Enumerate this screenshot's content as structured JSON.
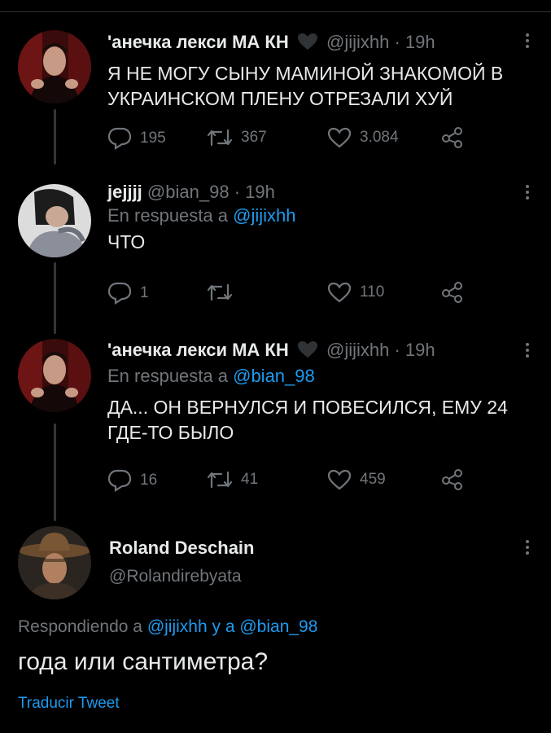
{
  "tweets": [
    {
      "name": "'анечка лекси МА КН",
      "handle": "@jijixhh",
      "dot": "·",
      "time": "19h",
      "text_lines": [
        "Я НЕ МОГУ СЫНУ МАМИНОЙ ЗНАКОМОЙ В",
        "УКРАИНСКОМ ПЛЕНУ ОТРЕЗАЛИ ХУЙ"
      ],
      "replies": "195",
      "retweets": "367",
      "likes": "3.084"
    },
    {
      "name": "jejjjj",
      "handle": "@bian_98",
      "dot": "·",
      "time": "19h",
      "reply_prefix": "En respuesta a",
      "reply_mention": "@jijixhh",
      "text_lines": [
        "ЧТО"
      ],
      "replies": "1",
      "retweets": "",
      "likes": "110"
    },
    {
      "name": "'анечка лекси МА КН",
      "handle": "@jijixhh",
      "dot": "·",
      "time": "19h",
      "reply_prefix": "En respuesta a",
      "reply_mention": "@bian_98",
      "text_lines": [
        "ДА... ОН ВЕРНУЛСЯ И ПОВЕСИЛСЯ, ЕМУ 24",
        "ГДЕ-ТО БЫЛО"
      ],
      "replies": "16",
      "retweets": "41",
      "likes": "459"
    }
  ],
  "main": {
    "name": "Roland Deschain",
    "handle": "@Rolandirebyata",
    "reply_prefix": "Respondiendo a",
    "mention_1": "@jijixhh",
    "conj": "y a",
    "mention_2": "@bian_98",
    "text": "года или сантиметра?",
    "translate": "Traducir Tweet"
  },
  "colors": {
    "background": "#000000",
    "text": "#e7e9ea",
    "muted": "#71767b",
    "link": "#1d9bf0",
    "thread_line": "#333639"
  },
  "icons": [
    "black-heart-icon",
    "more-icon",
    "reply-icon",
    "retweet-icon",
    "like-icon",
    "share-icon"
  ]
}
